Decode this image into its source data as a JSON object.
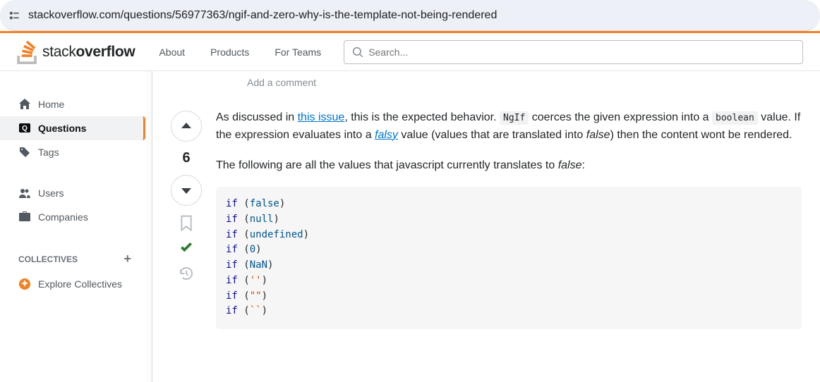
{
  "url": "stackoverflow.com/questions/56977363/ngif-and-zero-why-is-the-template-not-being-rendered",
  "logo": {
    "part1": "stack",
    "part2": "overflow"
  },
  "nav": {
    "about": "About",
    "products": "Products",
    "for_teams": "For Teams"
  },
  "search": {
    "placeholder": "Search..."
  },
  "sidebar": {
    "home": "Home",
    "questions": "Questions",
    "tags": "Tags",
    "users": "Users",
    "companies": "Companies",
    "collectives_heading": "COLLECTIVES",
    "explore": "Explore Collectives"
  },
  "add_comment": "Add a comment",
  "answer": {
    "score": "6",
    "p1_a": "As discussed in ",
    "p1_link": "this issue",
    "p1_b": ", this is the expected behavior. ",
    "p1_code1": "NgIf",
    "p1_c": " coerces the given expression into a ",
    "p1_code2": "boolean",
    "p1_d": " value. If the expression evaluates into a ",
    "p1_em_link": "falsy",
    "p1_e": " value (values that are translated into ",
    "p1_em": "false",
    "p1_f": ") then the content wont be rendered.",
    "p2_a": "The following are all the values that javascript currently translates to ",
    "p2_em": "false",
    "p2_b": ":",
    "code_lines": [
      {
        "kw": "if",
        "val": "false",
        "cls": "lit",
        "open": " (",
        "close": ")"
      },
      {
        "kw": "if",
        "val": "null",
        "cls": "lit",
        "open": " (",
        "close": ")"
      },
      {
        "kw": "if",
        "val": "undefined",
        "cls": "lit",
        "open": " (",
        "close": ")"
      },
      {
        "kw": "if",
        "val": "0",
        "cls": "lit",
        "open": " (",
        "close": ")"
      },
      {
        "kw": "if",
        "val": "NaN",
        "cls": "lit",
        "open": " (",
        "close": ")"
      },
      {
        "kw": "if",
        "val": "''",
        "cls": "str",
        "open": " (",
        "close": ")"
      },
      {
        "kw": "if",
        "val": "\"\"",
        "cls": "str",
        "open": " (",
        "close": ")"
      },
      {
        "kw": "if",
        "val": "``",
        "cls": "str",
        "open": " (",
        "close": ")"
      }
    ]
  }
}
